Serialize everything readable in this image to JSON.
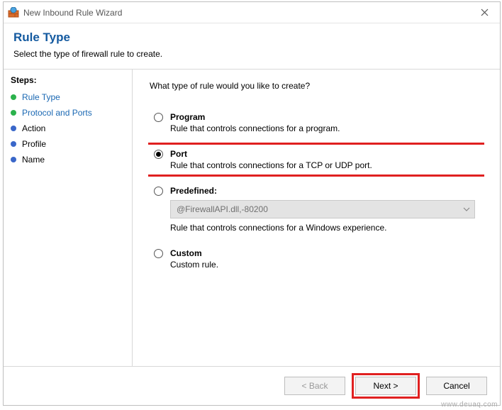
{
  "window": {
    "title": "New Inbound Rule Wizard"
  },
  "header": {
    "title": "Rule Type",
    "subtitle": "Select the type of firewall rule to create."
  },
  "sidebar": {
    "label": "Steps:",
    "items": [
      {
        "label": "Rule Type",
        "active": true
      },
      {
        "label": "Protocol and Ports",
        "active": true
      },
      {
        "label": "Action",
        "active": false
      },
      {
        "label": "Profile",
        "active": false
      },
      {
        "label": "Name",
        "active": false
      }
    ]
  },
  "main": {
    "question": "What type of rule would you like to create?",
    "options": {
      "program": {
        "label": "Program",
        "desc": "Rule that controls connections for a program."
      },
      "port": {
        "label": "Port",
        "desc": "Rule that controls connections for a TCP or UDP port."
      },
      "predefined": {
        "label": "Predefined:",
        "desc": "Rule that controls connections for a Windows experience.",
        "select_value": "@FirewallAPI.dll,-80200"
      },
      "custom": {
        "label": "Custom",
        "desc": "Custom rule."
      }
    },
    "selected": "port"
  },
  "footer": {
    "back": "< Back",
    "next": "Next >",
    "cancel": "Cancel"
  },
  "watermark": "www.deuaq.com"
}
